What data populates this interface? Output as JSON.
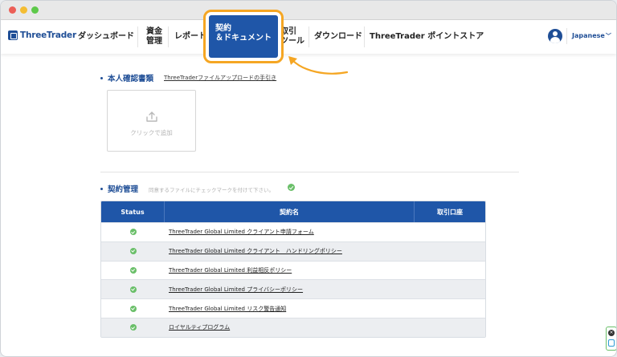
{
  "brand": {
    "name": "ThreeTrader",
    "color": "#1f4e96"
  },
  "nav": {
    "dashboard": "ダッシュボード",
    "funds_line1": "資金",
    "funds_line2": "管理",
    "report": "レポート",
    "active_line1": "契約",
    "active_line2": "＆ドキュメント",
    "tool_line1": "取引",
    "tool_line2": "ツール",
    "download": "ダウンロード",
    "point_store": "ThreeTrader ポイントストア",
    "language": "Japanese",
    "highlight_color": "#f5a623"
  },
  "identity_section": {
    "title": "本人確認書類",
    "help_link": "ThreeTraderファイルアップロードの手引き",
    "upload_label": "クリックで追加"
  },
  "contract_section": {
    "title": "契約管理",
    "note": "同意するファイルにチェックマークを付けて下さい。"
  },
  "table": {
    "headers": {
      "status": "Status",
      "name": "契約名",
      "account": "取引口座"
    },
    "rows": [
      {
        "name": "ThreeTrader Global Limited クライアント申請フォーム",
        "status": "checked"
      },
      {
        "name": "ThreeTrader Global Limited クライアント　ハンドリングポリシー",
        "status": "checked"
      },
      {
        "name": "ThreeTrader Global Limited 利益相反ポリシー",
        "status": "checked"
      },
      {
        "name": "ThreeTrader Global Limited プライバシーポリシー",
        "status": "checked"
      },
      {
        "name": "ThreeTrader Global Limited リスク警告通知",
        "status": "checked"
      },
      {
        "name": "ロイヤルティプログラム",
        "status": "checked"
      }
    ]
  },
  "icons": {
    "upload": "upload-icon",
    "check": "check-circle-icon",
    "user": "user-avatar-icon",
    "chevron": "chevron-down-icon",
    "widget_close": "close-icon",
    "widget_chat": "chat-icon"
  }
}
